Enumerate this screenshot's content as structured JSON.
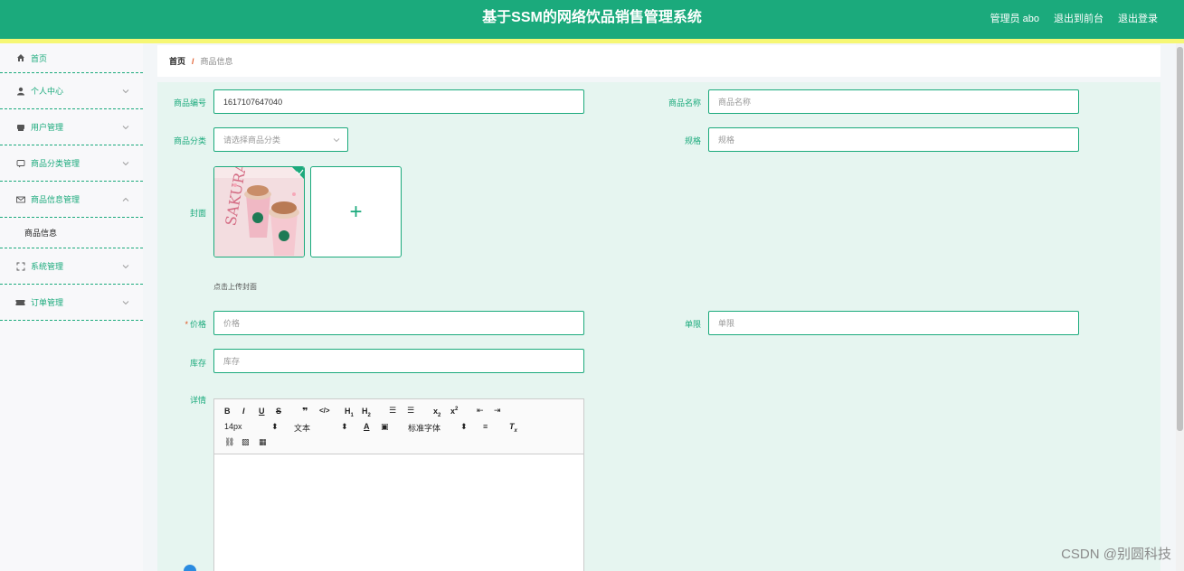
{
  "header": {
    "title": "基于SSM的网络饮品销售管理系统",
    "admin": "管理员 abo",
    "exit_front": "退出到前台",
    "logout": "退出登录"
  },
  "sidebar": {
    "items": [
      {
        "label": "首页",
        "icon": "home-icon"
      },
      {
        "label": "个人中心",
        "icon": "user-icon"
      },
      {
        "label": "用户管理",
        "icon": "users-icon"
      },
      {
        "label": "商品分类管理",
        "icon": "chat-icon"
      },
      {
        "label": "商品信息管理",
        "icon": "mail-icon"
      },
      {
        "label": "系统管理",
        "icon": "fullscreen-icon"
      },
      {
        "label": "订单管理",
        "icon": "ticket-icon"
      }
    ],
    "submenu": {
      "label": "商品信息"
    }
  },
  "breadcrumb": {
    "home": "首页",
    "separator": "/",
    "current": "商品信息"
  },
  "form": {
    "code_label": "商品编号",
    "code_value": "1617107647040",
    "name_label": "商品名称",
    "name_placeholder": "商品名称",
    "category_label": "商品分类",
    "category_placeholder": "请选择商品分类",
    "spec_label": "规格",
    "spec_placeholder": "规格",
    "cover_label": "封面",
    "cover_hint": "点击上传封面",
    "price_label": "价格",
    "price_placeholder": "价格",
    "limit_label": "单限",
    "limit_placeholder": "单限",
    "stock_label": "库存",
    "stock_placeholder": "库存",
    "detail_label": "详情"
  },
  "editor": {
    "font_size": "14px",
    "text_type": "文本",
    "font_family": "标准字体"
  },
  "watermark": "CSDN @别圆科技",
  "colors": {
    "accent": "#1baa7c",
    "stripe": "#f6f774",
    "panel": "#e6f5f0"
  }
}
